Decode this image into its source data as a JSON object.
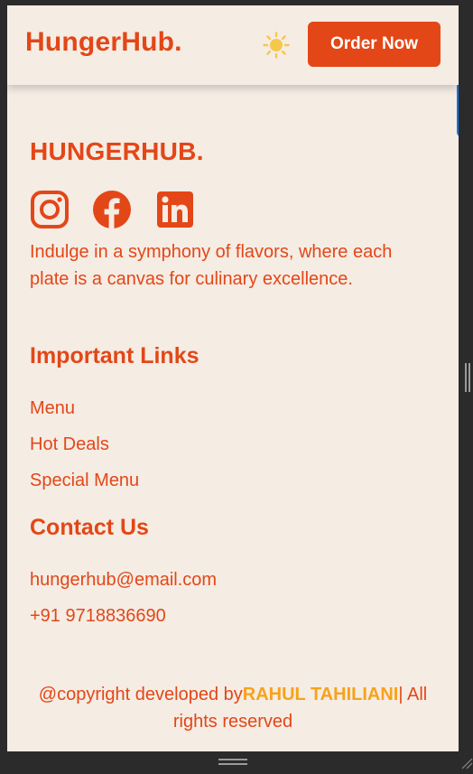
{
  "navbar": {
    "brand": "HungerHub.",
    "theme_icon": "sun-icon",
    "order_button": "Order Now"
  },
  "footer": {
    "brand": "HUNGERHUB.",
    "social": [
      {
        "name": "instagram-icon"
      },
      {
        "name": "facebook-icon"
      },
      {
        "name": "linkedin-icon"
      }
    ],
    "tagline": "Indulge in a symphony of flavors, where each plate is a canvas for culinary excellence.",
    "important_links": {
      "title": "Important Links",
      "items": [
        "Menu",
        "Hot Deals",
        "Special Menu"
      ]
    },
    "contact": {
      "title": "Contact Us",
      "email": "hungerhub@email.com",
      "phone": "+91 9718836690"
    },
    "copyright": {
      "prefix": "@copyright developed by",
      "author": "RAHUL TAHILIANI",
      "suffix": "| All rights reserved"
    }
  },
  "colors": {
    "accent": "#e34717",
    "background": "#f5ece4",
    "author": "#f7a21b",
    "button_text": "#ffffff"
  }
}
